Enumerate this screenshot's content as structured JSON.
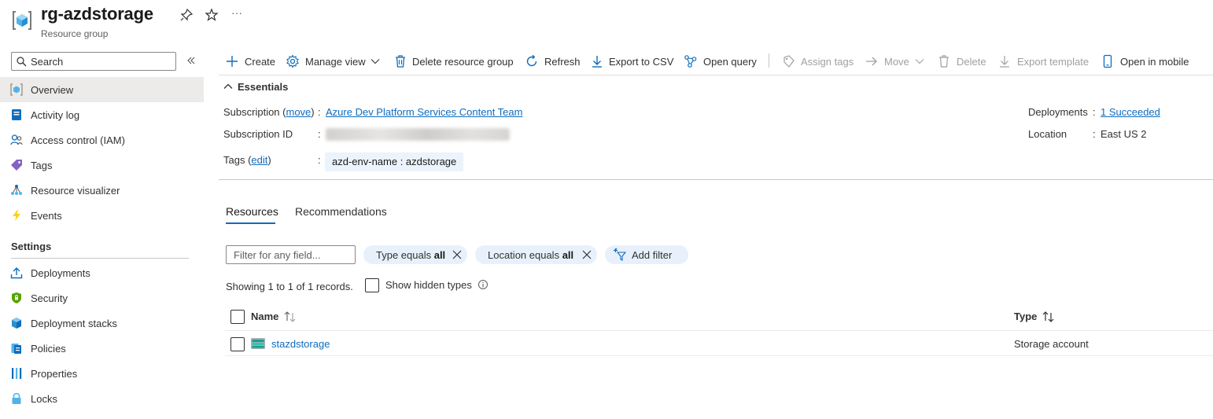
{
  "header": {
    "title": "rg-azdstorage",
    "subtitle": "Resource group",
    "more": "···"
  },
  "sidebar": {
    "search_placeholder": "Search",
    "items": [
      {
        "label": "Overview",
        "icon": "resource-group-icon"
      },
      {
        "label": "Activity log",
        "icon": "activity-log-icon"
      },
      {
        "label": "Access control (IAM)",
        "icon": "people-icon"
      },
      {
        "label": "Tags",
        "icon": "tag-icon"
      },
      {
        "label": "Resource visualizer",
        "icon": "visualizer-icon"
      },
      {
        "label": "Events",
        "icon": "lightning-icon"
      }
    ],
    "settings_title": "Settings",
    "settings_items": [
      {
        "label": "Deployments",
        "icon": "upload-icon"
      },
      {
        "label": "Security",
        "icon": "shield-icon"
      },
      {
        "label": "Deployment stacks",
        "icon": "stack-icon"
      },
      {
        "label": "Policies",
        "icon": "policy-icon"
      },
      {
        "label": "Properties",
        "icon": "properties-icon"
      },
      {
        "label": "Locks",
        "icon": "lock-icon"
      }
    ]
  },
  "toolbar": {
    "create": "Create",
    "manage_view": "Manage view",
    "delete_rg": "Delete resource group",
    "refresh": "Refresh",
    "export_csv": "Export to CSV",
    "open_query": "Open query",
    "assign_tags": "Assign tags",
    "move": "Move",
    "delete": "Delete",
    "export_template": "Export template",
    "open_mobile": "Open in mobile"
  },
  "essentials": {
    "title": "Essentials",
    "subscription_label": "Subscription",
    "move_link": "move",
    "subscription_value": "Azure Dev Platform Services Content Team",
    "subscription_id_label": "Subscription ID",
    "tags_label": "Tags",
    "edit_link": "edit",
    "tag_value": "azd-env-name : azdstorage",
    "deployments_label": "Deployments",
    "deployments_value": "1 Succeeded",
    "location_label": "Location",
    "location_value": "East US 2"
  },
  "tabs": [
    {
      "label": "Resources",
      "active": true
    },
    {
      "label": "Recommendations",
      "active": false
    }
  ],
  "filters": {
    "placeholder": "Filter for any field...",
    "type_prefix": "Type equals ",
    "type_value": "all",
    "location_prefix": "Location equals ",
    "location_value": "all",
    "add_filter": "Add filter"
  },
  "records": {
    "showing": "Showing 1 to 1 of 1 records.",
    "show_hidden": "Show hidden types"
  },
  "grid": {
    "col_name": "Name",
    "col_type": "Type",
    "rows": [
      {
        "name": "stazdstorage",
        "type": "Storage account"
      }
    ]
  },
  "colors": {
    "accent": "#0f6cbd",
    "selected_nav": "#edebe9",
    "pill_bg": "#e8f1fb"
  }
}
